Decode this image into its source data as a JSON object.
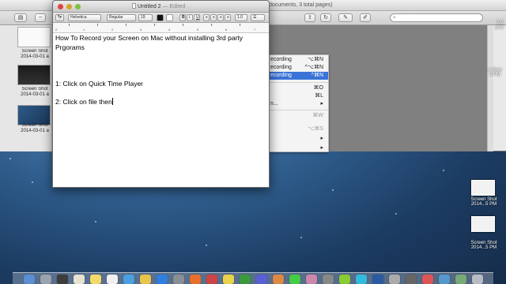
{
  "preview": {
    "title": "documents, 3 total pages)",
    "search_placeholder": "",
    "thumbnails": [
      {
        "label_line1": "Screen Shot",
        "label_line2": "2014-03-01 a"
      },
      {
        "label_line1": "Screen Shot",
        "label_line2": "2014-03-01 a"
      },
      {
        "label_line1": "Screen Shot",
        "label_line2": "2014-03-01 a"
      }
    ],
    "menu_items": [
      {
        "label": "ecording",
        "shortcut": "⌥⌘N",
        "highlighted": false
      },
      {
        "label": "ecording",
        "shortcut": "^⌥⌘N",
        "highlighted": false
      },
      {
        "label": "ecording",
        "shortcut": "^⌘N",
        "highlighted": true
      },
      {
        "label": "",
        "shortcut": "⌘O",
        "highlighted": false
      },
      {
        "label": "",
        "shortcut": "⌘L",
        "highlighted": false
      },
      {
        "label": "n...",
        "shortcut": "▸",
        "highlighted": false
      },
      {
        "label": "",
        "shortcut": "⌘W",
        "highlighted": false
      },
      {
        "label": "",
        "shortcut": "⌥⌘S",
        "highlighted": false
      },
      {
        "label": "",
        "shortcut": "▸",
        "highlighted": false
      },
      {
        "label": "",
        "shortcut": "▸",
        "highlighted": false
      }
    ]
  },
  "desktop_right": {
    "label_top": "7.0",
    "label_top2": "psw",
    "items": [
      {
        "line1": "n Shot",
        "line2": "5 PM"
      },
      {
        "line1": "Screen Shot",
        "line2": "2014...5 PM"
      },
      {
        "line1": "Screen Shot",
        "line2": "2014...5 PM"
      }
    ]
  },
  "textedit": {
    "title": "Untitled 2",
    "edited": "— Edited",
    "format": {
      "paragraph_style": "¶▾",
      "font": "Helvetica",
      "typeface": "Regular",
      "size": "19",
      "bold": "B",
      "italic": "I",
      "underline": "U",
      "spacing": "1.0"
    },
    "ruler_numbers": [
      "0",
      "1",
      "2",
      "3",
      "4",
      "5",
      "6",
      "7"
    ],
    "lines": [
      "How To Record your Screen on Mac without installing 3rd party",
      "Prgorams",
      "1: Click on Quick Time Player",
      "2: Click on file then"
    ]
  },
  "colors": {
    "desktop": "#2f5d8d",
    "menu_highlight": "#3a73d8",
    "close": "#e0443e",
    "minimize": "#dea123",
    "zoom": "#7fc03f"
  },
  "dock_icons": [
    "finder-icon",
    "launchpad-icon",
    "mission-control-icon",
    "calendar-icon",
    "notes-icon",
    "reminders-icon",
    "safari-icon",
    "chrome-icon",
    "app-store-icon",
    "system-preferences-icon",
    "firefox-icon",
    "app-icon-1",
    "app-icon-2",
    "app-icon-3",
    "app-icon-4",
    "app-icon-5",
    "app-icon-6",
    "app-icon-7",
    "app-icon-8",
    "app-icon-9",
    "app-icon-10",
    "quicktime-icon",
    "app-icon-11",
    "app-icon-12",
    "app-icon-13",
    "app-icon-14",
    "downloads-icon",
    "trash-icon"
  ]
}
